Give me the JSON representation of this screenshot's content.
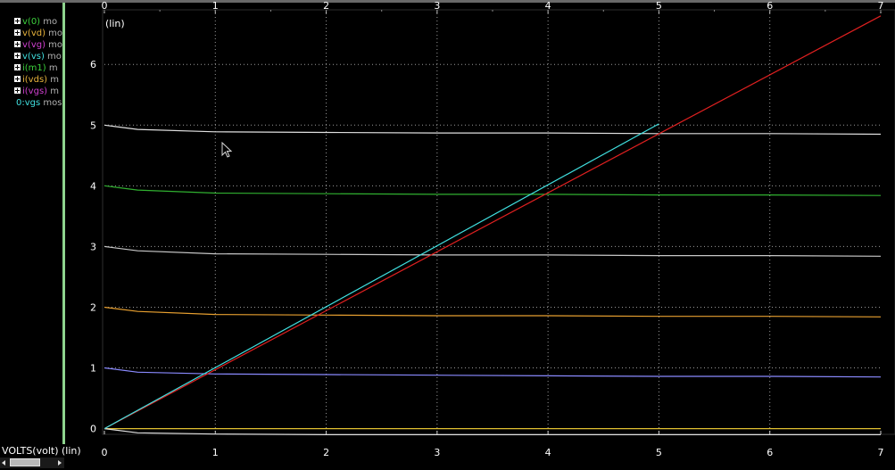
{
  "legend": [
    {
      "name": "v(0)",
      "suffix": "mo",
      "color": "#3cd23c"
    },
    {
      "name": "v(vd)",
      "suffix": "mo",
      "color": "#e8b43c"
    },
    {
      "name": "v(vg)",
      "suffix": "mo",
      "color": "#d040d0"
    },
    {
      "name": "v(vs)",
      "suffix": "mo",
      "color": "#40e0e0"
    },
    {
      "name": "i(m1)",
      "suffix": "m",
      "color": "#3cd23c"
    },
    {
      "name": "i(vds)",
      "suffix": "m",
      "color": "#e8b43c"
    },
    {
      "name": "i(vgs)",
      "suffix": "m",
      "color": "#d040d0"
    },
    {
      "name": "0:vgs",
      "suffix": "mos",
      "color": "#40e0e0"
    }
  ],
  "xlabel": "VOLTS(volt) (lin)",
  "chart_data": {
    "type": "line",
    "title": "",
    "xlabel": "VOLTS(volt) (lin)",
    "ylabel": "(lin)",
    "xlim": [
      0,
      7
    ],
    "ylim": [
      -0.08,
      6.9
    ],
    "x_ticks": [
      "0",
      "1",
      "2",
      "3",
      "4",
      "5",
      "6",
      "7"
    ],
    "y_ticks": [
      "0",
      "1",
      "2",
      "3",
      "4",
      "5",
      "6"
    ],
    "grid": true,
    "series": [
      {
        "color": "#e0e0e0",
        "x": [
          0,
          0.3,
          1,
          2,
          3,
          4,
          5,
          6,
          7
        ],
        "y": [
          5.0,
          4.93,
          4.89,
          4.88,
          4.87,
          4.87,
          4.86,
          4.86,
          4.85
        ]
      },
      {
        "color": "#30b030",
        "x": [
          0,
          0.3,
          1,
          2,
          3,
          4,
          5,
          6,
          7
        ],
        "y": [
          4.0,
          3.93,
          3.88,
          3.87,
          3.86,
          3.86,
          3.85,
          3.85,
          3.84
        ]
      },
      {
        "color": "#c8c8c8",
        "x": [
          0,
          0.3,
          1,
          2,
          3,
          4,
          5,
          6,
          7
        ],
        "y": [
          3.0,
          2.93,
          2.88,
          2.87,
          2.86,
          2.86,
          2.85,
          2.85,
          2.84
        ]
      },
      {
        "color": "#e8a030",
        "x": [
          0,
          0.3,
          1,
          2,
          3,
          4,
          5,
          6,
          7
        ],
        "y": [
          2.0,
          1.93,
          1.88,
          1.87,
          1.86,
          1.86,
          1.85,
          1.85,
          1.84
        ]
      },
      {
        "color": "#8a8aff",
        "x": [
          0,
          0.3,
          1,
          2,
          3,
          4,
          5,
          6,
          7
        ],
        "y": [
          1.0,
          0.93,
          0.9,
          0.89,
          0.88,
          0.87,
          0.86,
          0.86,
          0.85
        ]
      },
      {
        "color": "#e0c030",
        "x": [
          0,
          7
        ],
        "y": [
          0.0,
          0.0
        ]
      },
      {
        "color": "#e0e0e0",
        "x": [
          0,
          0.3,
          1,
          2,
          3,
          4,
          5,
          6,
          7
        ],
        "y": [
          0.0,
          -0.07,
          -0.09,
          -0.1,
          -0.1,
          -0.1,
          -0.1,
          -0.1,
          -0.1
        ]
      },
      {
        "color": "#e02020",
        "x": [
          0,
          7
        ],
        "y": [
          0.0,
          6.8
        ]
      },
      {
        "color": "#40e0e0",
        "x": [
          0,
          5
        ],
        "y": [
          0.0,
          5.02
        ]
      }
    ]
  }
}
